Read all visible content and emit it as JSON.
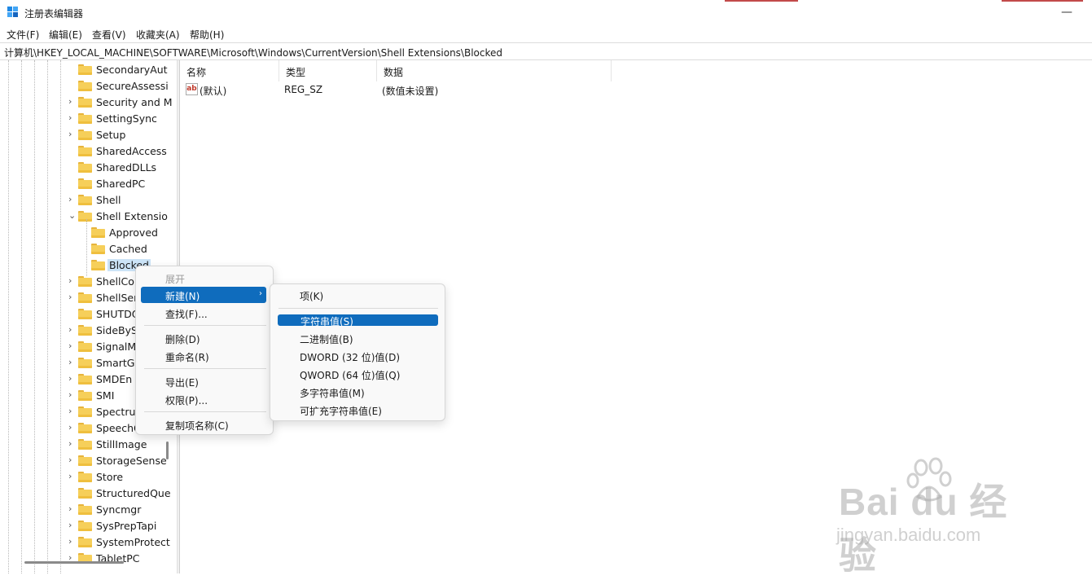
{
  "window": {
    "title": "注册表编辑器",
    "minimize": "—"
  },
  "menubar": [
    "文件(F)",
    "编辑(E)",
    "查看(V)",
    "收藏夹(A)",
    "帮助(H)"
  ],
  "address": "计算机\\HKEY_LOCAL_MACHINE\\SOFTWARE\\Microsoft\\Windows\\CurrentVersion\\Shell Extensions\\Blocked",
  "tree": {
    "items": [
      {
        "label": "SecondaryAut",
        "expander": ""
      },
      {
        "label": "SecureAssessi",
        "expander": ""
      },
      {
        "label": "Security and M",
        "expander": "›"
      },
      {
        "label": "SettingSync",
        "expander": "›"
      },
      {
        "label": "Setup",
        "expander": "›"
      },
      {
        "label": "SharedAccess",
        "expander": ""
      },
      {
        "label": "SharedDLLs",
        "expander": ""
      },
      {
        "label": "SharedPC",
        "expander": ""
      },
      {
        "label": "Shell",
        "expander": "›"
      },
      {
        "label": "Shell Extensio",
        "expander": "⌄"
      },
      {
        "label": "Approved",
        "expander": ""
      },
      {
        "label": "Cached",
        "expander": ""
      },
      {
        "label": "Blocked",
        "expander": ""
      },
      {
        "label": "ShellCom",
        "expander": "›"
      },
      {
        "label": "ShellSer",
        "expander": "›"
      },
      {
        "label": "SHUTDO",
        "expander": ""
      },
      {
        "label": "SideByS",
        "expander": "›"
      },
      {
        "label": "SignalM",
        "expander": "›"
      },
      {
        "label": "SmartGl",
        "expander": "›"
      },
      {
        "label": "SMDEn",
        "expander": "›"
      },
      {
        "label": "SMI",
        "expander": "›"
      },
      {
        "label": "Spectrun",
        "expander": "›"
      },
      {
        "label": "SpeechG",
        "expander": "›"
      },
      {
        "label": "StillImage",
        "expander": "›"
      },
      {
        "label": "StorageSense",
        "expander": "›"
      },
      {
        "label": "Store",
        "expander": "›"
      },
      {
        "label": "StructuredQue",
        "expander": ""
      },
      {
        "label": "Syncmgr",
        "expander": "›"
      },
      {
        "label": "SysPrepTapi",
        "expander": "›"
      },
      {
        "label": "SystemProtect",
        "expander": "›"
      },
      {
        "label": "TabletPC",
        "expander": "›"
      }
    ]
  },
  "list": {
    "headers": [
      "名称",
      "类型",
      "数据"
    ],
    "rows": [
      {
        "name": "(默认)",
        "type": "REG_SZ",
        "data": "(数值未设置)",
        "icon": "ab"
      }
    ]
  },
  "context_menu": {
    "items": [
      "展开",
      "新建(N)",
      "查找(F)...",
      "删除(D)",
      "重命名(R)",
      "导出(E)",
      "权限(P)...",
      "复制项名称(C)"
    ],
    "submenu_arrow": "›"
  },
  "submenu": {
    "items": [
      "项(K)",
      "字符串值(S)",
      "二进制值(B)",
      "DWORD (32 位)值(D)",
      "QWORD (64 位)值(Q)",
      "多字符串值(M)",
      "可扩充字符串值(E)"
    ]
  },
  "watermark": {
    "main": "Bai du 经验",
    "sub": "jingyan.baidu.com"
  },
  "colors": {
    "highlight": "#0f6cbd",
    "selection": "#cce4f7",
    "folder": "#f6cf5a"
  }
}
